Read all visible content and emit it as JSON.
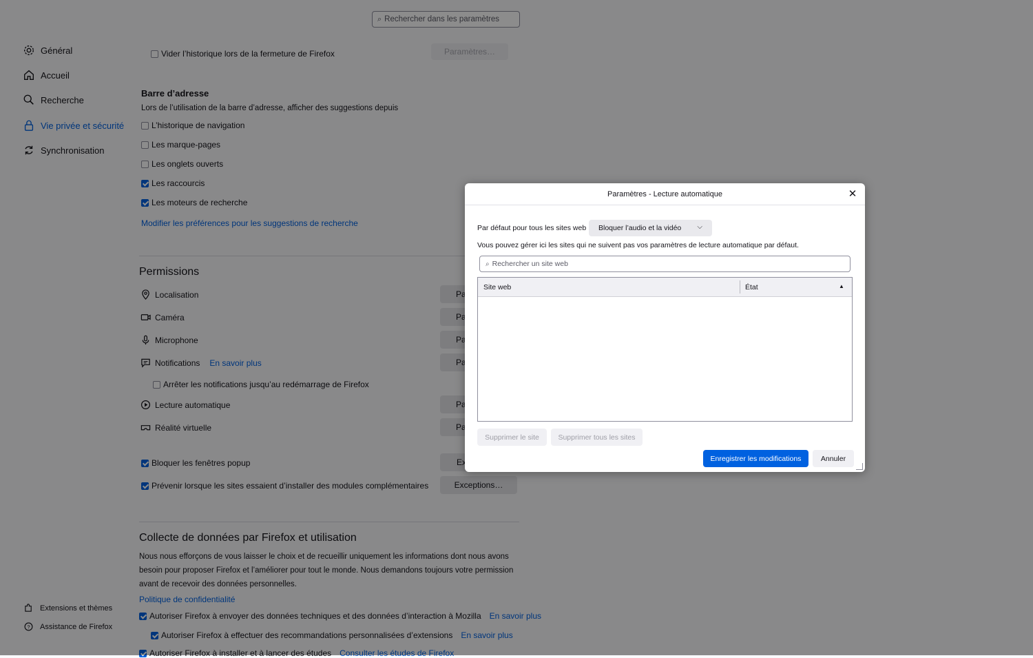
{
  "search": {
    "placeholder": "Rechercher dans les paramètres"
  },
  "sidebar": {
    "items": [
      {
        "label": "Général",
        "icon": "gear-icon"
      },
      {
        "label": "Accueil",
        "icon": "home-icon"
      },
      {
        "label": "Recherche",
        "icon": "search-icon"
      },
      {
        "label": "Vie privée et sécurité",
        "icon": "lock-icon",
        "active": true
      },
      {
        "label": "Synchronisation",
        "icon": "sync-icon"
      }
    ],
    "footer": [
      {
        "label": "Extensions et thèmes",
        "icon": "puzzle-icon"
      },
      {
        "label": "Assistance de Firefox",
        "icon": "help-icon"
      }
    ]
  },
  "history": {
    "clear_label": "Vider l’historique lors de la fermeture de Firefox",
    "settings_button": "Paramètres…"
  },
  "address_bar": {
    "title": "Barre d’adresse",
    "description": "Lors de l’utilisation de la barre d’adresse, afficher des suggestions depuis",
    "options": [
      {
        "label": "L’historique de navigation",
        "checked": false
      },
      {
        "label": "Les marque-pages",
        "checked": false
      },
      {
        "label": "Les onglets ouverts",
        "checked": false
      },
      {
        "label": "Les raccourcis",
        "checked": true
      },
      {
        "label": "Les moteurs de recherche",
        "checked": true
      }
    ],
    "pref_link": "Modifier les préférences pour les suggestions de recherche"
  },
  "permissions": {
    "title": "Permissions",
    "items": [
      {
        "label": "Localisation",
        "icon": "location-icon",
        "button": "Pa"
      },
      {
        "label": "Caméra",
        "icon": "camera-icon",
        "button": "Pa"
      },
      {
        "label": "Microphone",
        "icon": "microphone-icon",
        "button": "Pa"
      },
      {
        "label": "Notifications",
        "icon": "notification-icon",
        "button": "Pa"
      },
      {
        "label": "Lecture automatique",
        "icon": "autoplay-icon",
        "button": "Pa"
      },
      {
        "label": "Réalité virtuelle",
        "icon": "vr-icon",
        "button": "Pa"
      }
    ],
    "notifications_link": "En savoir plus",
    "pause_notifications": "Arrêter les notifications jusqu’au redémarrage de Firefox",
    "block_popups": "Bloquer les fenêtres popup",
    "block_popups_button": "Ex",
    "warn_addons": "Prévenir lorsque les sites essaient d’installer des modules complémentaires",
    "warn_addons_button": "Exceptions…"
  },
  "data_collection": {
    "title": "Collecte de données par Firefox et utilisation",
    "text_lines": [
      "Nous nous efforçons de vous laisser le choix et de recueillir uniquement les informations dont nous avons",
      "besoin pour proposer Firefox et l’améliorer pour tout le monde. Nous demandons toujours votre permission",
      "avant de recevoir des données personnelles."
    ],
    "privacy_link": "Politique de confidentialité",
    "options": [
      {
        "label": "Autoriser Firefox à envoyer des données techniques et des données d’interaction à Mozilla",
        "link": "En savoir plus"
      },
      {
        "label": "Autoriser Firefox à effectuer des recommandations personnalisées d’extensions",
        "link": "En savoir plus"
      },
      {
        "label": "Autoriser Firefox à installer et à lancer des études",
        "link": "Consulter les études de Firefox"
      }
    ]
  },
  "dialog": {
    "title": "Paramètres - Lecture automatique",
    "default_label": "Par défaut pour tous les sites web :",
    "default_value": "Bloquer l’audio et la vidéo",
    "description": "Vous pouvez gérer ici les sites qui ne suivent pas vos paramètres de lecture automatique par défaut.",
    "search_placeholder": "Rechercher un site web",
    "columns": [
      "Site web",
      "État"
    ],
    "remove_site": "Supprimer le site",
    "remove_all": "Supprimer tous les sites",
    "save": "Enregistrer les modifications",
    "cancel": "Annuler"
  }
}
